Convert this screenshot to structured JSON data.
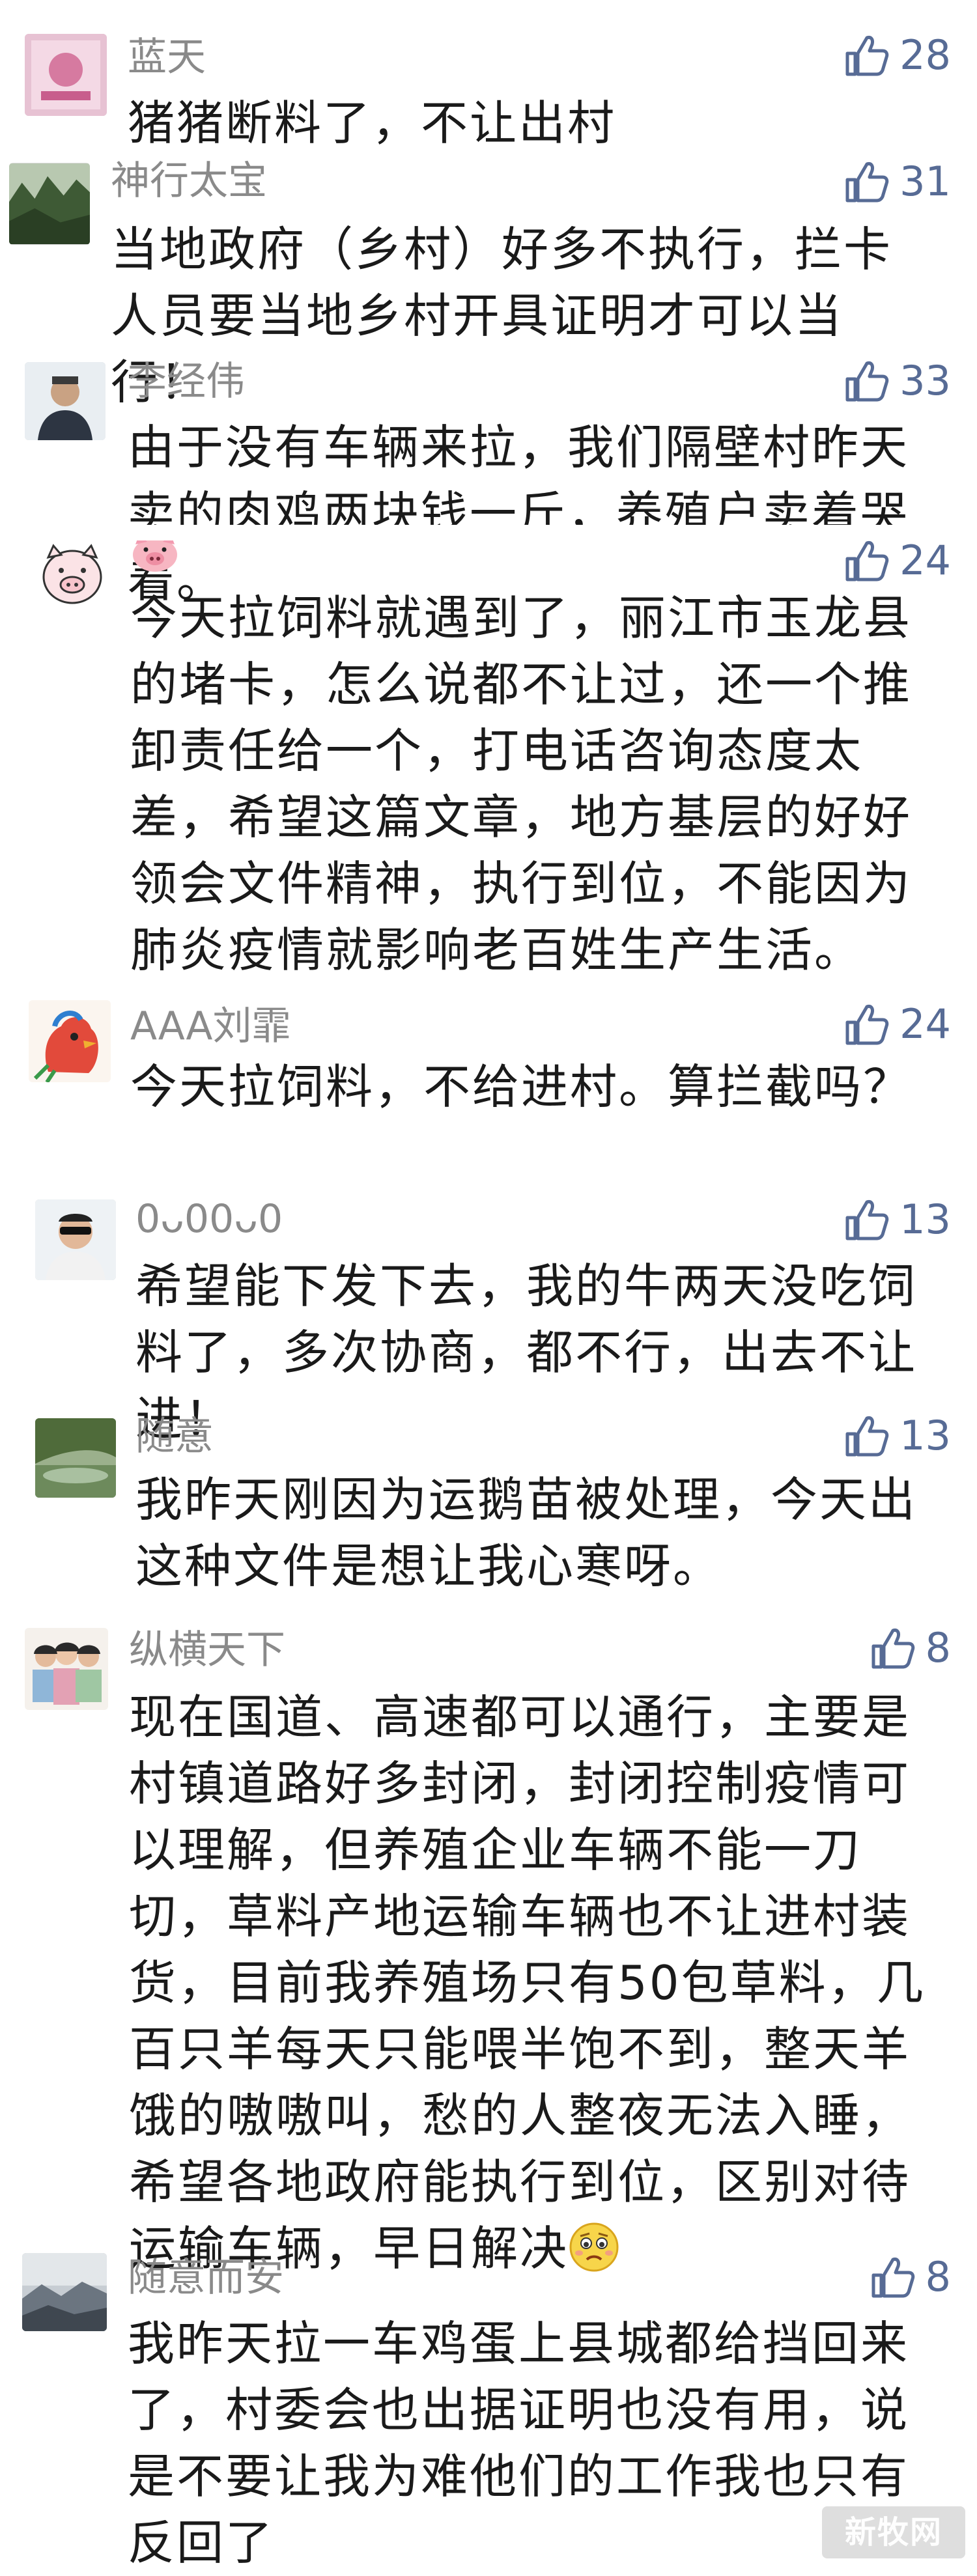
{
  "comments": [
    {
      "name": "蓝天",
      "likes": "28",
      "text": "猪猪断料了，不让出村"
    },
    {
      "name": "神行太宝",
      "likes": "31",
      "text": "当地政府（乡村）好多不执行，拦卡人员要当地乡村开具证明才可以当行！"
    },
    {
      "name": "李经伟",
      "likes": "33",
      "text": "由于没有车辆来拉，我们隔壁村昨天卖的肉鸡两块钱一斤，养殖户卖着哭着。"
    },
    {
      "name": "",
      "likes": "24",
      "text": "今天拉饲料就遇到了，丽江市玉龙县的堵卡，怎么说都不让过，还一个推卸责任给一个，打电话咨询态度太差，希望这篇文章，地方基层的好好领会文件精神，执行到位，不能因为肺炎疫情就影响老百姓生产生活。"
    },
    {
      "name": "AAA刘霏",
      "likes": "24",
      "text": "今天拉饲料，不给进村。算拦截吗？"
    },
    {
      "name": "0ᴗ00ᴗ0",
      "likes": "13",
      "text": "希望能下发下去，我的牛两天没吃饲料了，多次协商，都不行，出去不让进！"
    },
    {
      "name": "随意",
      "likes": "13",
      "text": "我昨天刚因为运鹅苗被处理，今天出这种文件是想让我心寒呀。"
    },
    {
      "name": "纵横天下",
      "likes": "8",
      "text": "现在国道、高速都可以通行，主要是村镇道路好多封闭，封闭控制疫情可以理解，但养殖企业车辆不能一刀切，草料产地运输车辆也不让进村装货，目前我养殖场只有50包草料，几百只羊每天只能喂半饱不到，整天羊饿的嗷嗷叫，愁的人整夜无法入睡，希望各地政府能执行到位，区别对待运输车辆，早日解决"
    },
    {
      "name": "随意而安",
      "likes": "8",
      "text": "我昨天拉一车鸡蛋上县城都给挡回来了，村委会也出据证明也没有用，说是不要让我为难他们的工作我也只有反回了"
    }
  ],
  "watermark": "新牧网",
  "icons": {
    "like": "thumbs-up-icon",
    "emoji": "worried-face-icon"
  },
  "colors": {
    "like": "#576b95",
    "name": "#8a8a8a",
    "text": "#1a1a1a"
  }
}
